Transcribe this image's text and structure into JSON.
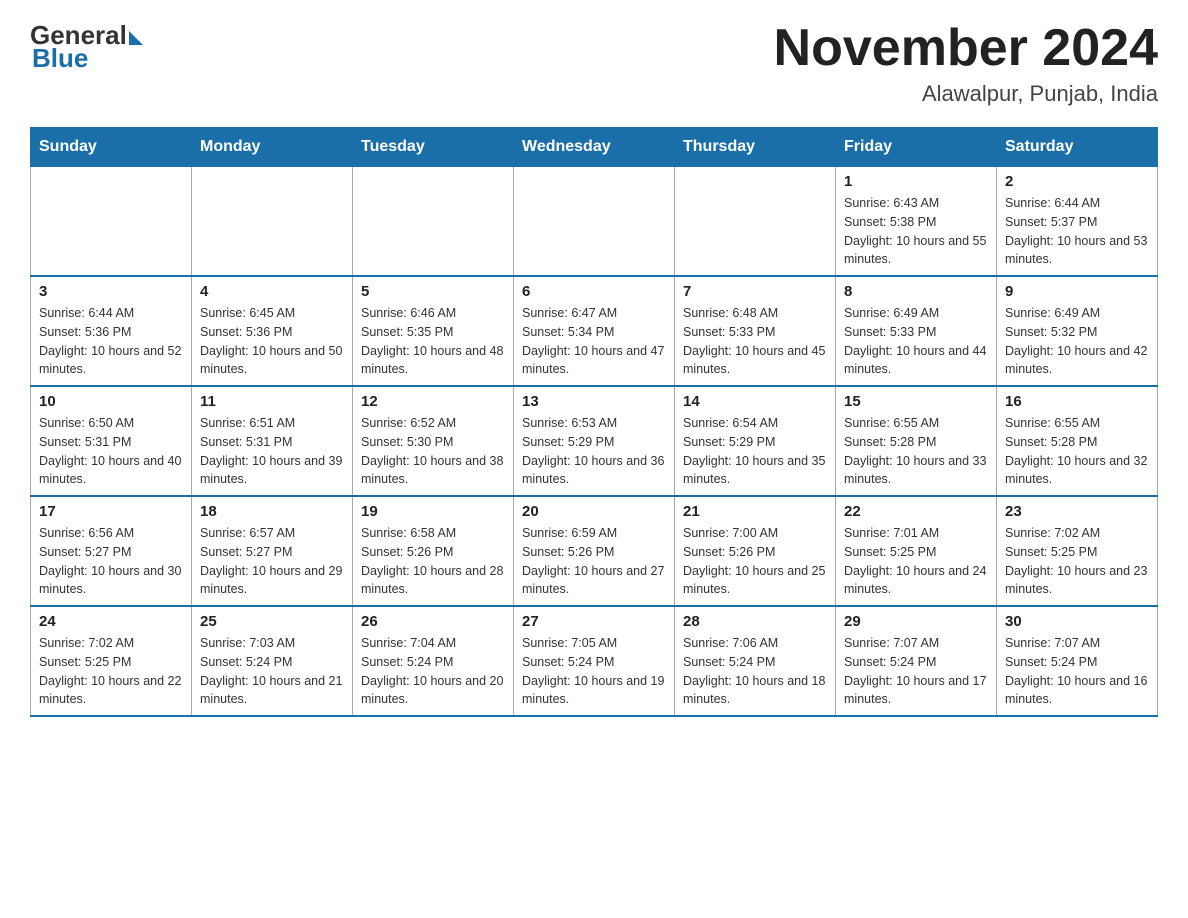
{
  "header": {
    "logo": {
      "general": "General",
      "blue": "Blue"
    },
    "title": "November 2024",
    "subtitle": "Alawalpur, Punjab, India"
  },
  "weekdays": [
    "Sunday",
    "Monday",
    "Tuesday",
    "Wednesday",
    "Thursday",
    "Friday",
    "Saturday"
  ],
  "weeks": [
    [
      {
        "day": "",
        "sunrise": "",
        "sunset": "",
        "daylight": ""
      },
      {
        "day": "",
        "sunrise": "",
        "sunset": "",
        "daylight": ""
      },
      {
        "day": "",
        "sunrise": "",
        "sunset": "",
        "daylight": ""
      },
      {
        "day": "",
        "sunrise": "",
        "sunset": "",
        "daylight": ""
      },
      {
        "day": "",
        "sunrise": "",
        "sunset": "",
        "daylight": ""
      },
      {
        "day": "1",
        "sunrise": "Sunrise: 6:43 AM",
        "sunset": "Sunset: 5:38 PM",
        "daylight": "Daylight: 10 hours and 55 minutes."
      },
      {
        "day": "2",
        "sunrise": "Sunrise: 6:44 AM",
        "sunset": "Sunset: 5:37 PM",
        "daylight": "Daylight: 10 hours and 53 minutes."
      }
    ],
    [
      {
        "day": "3",
        "sunrise": "Sunrise: 6:44 AM",
        "sunset": "Sunset: 5:36 PM",
        "daylight": "Daylight: 10 hours and 52 minutes."
      },
      {
        "day": "4",
        "sunrise": "Sunrise: 6:45 AM",
        "sunset": "Sunset: 5:36 PM",
        "daylight": "Daylight: 10 hours and 50 minutes."
      },
      {
        "day": "5",
        "sunrise": "Sunrise: 6:46 AM",
        "sunset": "Sunset: 5:35 PM",
        "daylight": "Daylight: 10 hours and 48 minutes."
      },
      {
        "day": "6",
        "sunrise": "Sunrise: 6:47 AM",
        "sunset": "Sunset: 5:34 PM",
        "daylight": "Daylight: 10 hours and 47 minutes."
      },
      {
        "day": "7",
        "sunrise": "Sunrise: 6:48 AM",
        "sunset": "Sunset: 5:33 PM",
        "daylight": "Daylight: 10 hours and 45 minutes."
      },
      {
        "day": "8",
        "sunrise": "Sunrise: 6:49 AM",
        "sunset": "Sunset: 5:33 PM",
        "daylight": "Daylight: 10 hours and 44 minutes."
      },
      {
        "day": "9",
        "sunrise": "Sunrise: 6:49 AM",
        "sunset": "Sunset: 5:32 PM",
        "daylight": "Daylight: 10 hours and 42 minutes."
      }
    ],
    [
      {
        "day": "10",
        "sunrise": "Sunrise: 6:50 AM",
        "sunset": "Sunset: 5:31 PM",
        "daylight": "Daylight: 10 hours and 40 minutes."
      },
      {
        "day": "11",
        "sunrise": "Sunrise: 6:51 AM",
        "sunset": "Sunset: 5:31 PM",
        "daylight": "Daylight: 10 hours and 39 minutes."
      },
      {
        "day": "12",
        "sunrise": "Sunrise: 6:52 AM",
        "sunset": "Sunset: 5:30 PM",
        "daylight": "Daylight: 10 hours and 38 minutes."
      },
      {
        "day": "13",
        "sunrise": "Sunrise: 6:53 AM",
        "sunset": "Sunset: 5:29 PM",
        "daylight": "Daylight: 10 hours and 36 minutes."
      },
      {
        "day": "14",
        "sunrise": "Sunrise: 6:54 AM",
        "sunset": "Sunset: 5:29 PM",
        "daylight": "Daylight: 10 hours and 35 minutes."
      },
      {
        "day": "15",
        "sunrise": "Sunrise: 6:55 AM",
        "sunset": "Sunset: 5:28 PM",
        "daylight": "Daylight: 10 hours and 33 minutes."
      },
      {
        "day": "16",
        "sunrise": "Sunrise: 6:55 AM",
        "sunset": "Sunset: 5:28 PM",
        "daylight": "Daylight: 10 hours and 32 minutes."
      }
    ],
    [
      {
        "day": "17",
        "sunrise": "Sunrise: 6:56 AM",
        "sunset": "Sunset: 5:27 PM",
        "daylight": "Daylight: 10 hours and 30 minutes."
      },
      {
        "day": "18",
        "sunrise": "Sunrise: 6:57 AM",
        "sunset": "Sunset: 5:27 PM",
        "daylight": "Daylight: 10 hours and 29 minutes."
      },
      {
        "day": "19",
        "sunrise": "Sunrise: 6:58 AM",
        "sunset": "Sunset: 5:26 PM",
        "daylight": "Daylight: 10 hours and 28 minutes."
      },
      {
        "day": "20",
        "sunrise": "Sunrise: 6:59 AM",
        "sunset": "Sunset: 5:26 PM",
        "daylight": "Daylight: 10 hours and 27 minutes."
      },
      {
        "day": "21",
        "sunrise": "Sunrise: 7:00 AM",
        "sunset": "Sunset: 5:26 PM",
        "daylight": "Daylight: 10 hours and 25 minutes."
      },
      {
        "day": "22",
        "sunrise": "Sunrise: 7:01 AM",
        "sunset": "Sunset: 5:25 PM",
        "daylight": "Daylight: 10 hours and 24 minutes."
      },
      {
        "day": "23",
        "sunrise": "Sunrise: 7:02 AM",
        "sunset": "Sunset: 5:25 PM",
        "daylight": "Daylight: 10 hours and 23 minutes."
      }
    ],
    [
      {
        "day": "24",
        "sunrise": "Sunrise: 7:02 AM",
        "sunset": "Sunset: 5:25 PM",
        "daylight": "Daylight: 10 hours and 22 minutes."
      },
      {
        "day": "25",
        "sunrise": "Sunrise: 7:03 AM",
        "sunset": "Sunset: 5:24 PM",
        "daylight": "Daylight: 10 hours and 21 minutes."
      },
      {
        "day": "26",
        "sunrise": "Sunrise: 7:04 AM",
        "sunset": "Sunset: 5:24 PM",
        "daylight": "Daylight: 10 hours and 20 minutes."
      },
      {
        "day": "27",
        "sunrise": "Sunrise: 7:05 AM",
        "sunset": "Sunset: 5:24 PM",
        "daylight": "Daylight: 10 hours and 19 minutes."
      },
      {
        "day": "28",
        "sunrise": "Sunrise: 7:06 AM",
        "sunset": "Sunset: 5:24 PM",
        "daylight": "Daylight: 10 hours and 18 minutes."
      },
      {
        "day": "29",
        "sunrise": "Sunrise: 7:07 AM",
        "sunset": "Sunset: 5:24 PM",
        "daylight": "Daylight: 10 hours and 17 minutes."
      },
      {
        "day": "30",
        "sunrise": "Sunrise: 7:07 AM",
        "sunset": "Sunset: 5:24 PM",
        "daylight": "Daylight: 10 hours and 16 minutes."
      }
    ]
  ]
}
